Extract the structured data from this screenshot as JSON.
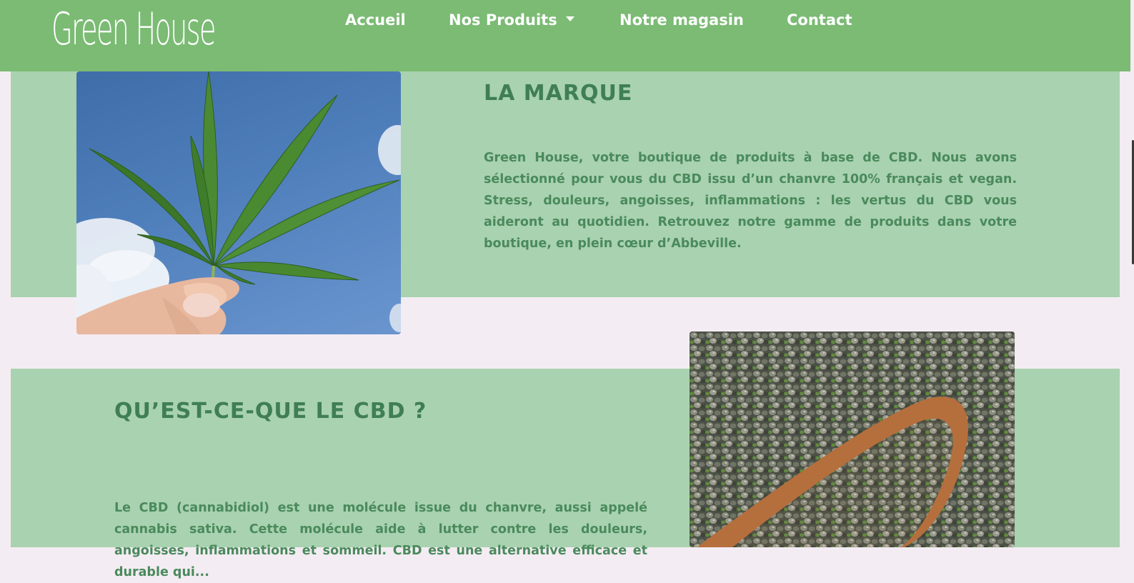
{
  "navbar": {
    "brand": "Green House",
    "items": [
      {
        "label": "Accueil"
      },
      {
        "label": "Nos Produits",
        "has_dropdown": true
      },
      {
        "label": "Notre magasin"
      },
      {
        "label": "Contact"
      }
    ]
  },
  "sections": [
    {
      "title": "LA MARQUE",
      "text": "Green House, votre boutique de produits à base de CBD. Nous avons sélectionné pour vous du CBD issu d’un chanvre 100% français et vegan. Stress, douleurs, angoisses, inflammations : les vertus du CBD vous aideront au quotidien. Retrouvez notre gamme de produits dans votre boutique, en plein cœur d’Abbeville."
    },
    {
      "title": "QU’EST-CE-QUE LE CBD ?",
      "text": "Le CBD (cannabidiol) est une molécule issue du chanvre, aussi appelé cannabis sativa. Cette molécule aide à lutter contre les douleurs, angoisses, inflammations et sommeil. CBD est une alternative efficace et durable qui..."
    }
  ],
  "colors": {
    "navbar": "#7bbb74",
    "band": "#a9d2b0",
    "page_background": "#f4ecf3",
    "heading": "#3f7f53",
    "text": "#4a8a5c"
  },
  "images": [
    {
      "icon": "cannabis-leaf-in-hand-photo"
    },
    {
      "icon": "hemp-seeds-wooden-spoon-photo"
    }
  ]
}
